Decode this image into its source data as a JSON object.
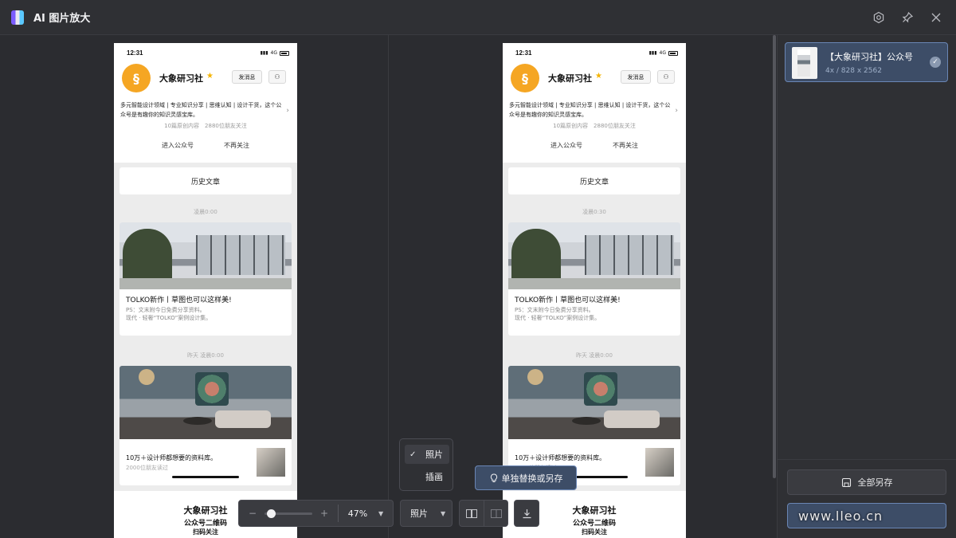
{
  "app": {
    "title": "AI 图片放大",
    "icons": [
      "settings-icon",
      "pin-icon",
      "close-icon"
    ]
  },
  "preview": {
    "status_time": "12:31",
    "status_network": "4G",
    "account_name": "大象研习社",
    "message_button": "发消息",
    "description": "多元智能设计领域 | 专业知识分享 | 思维认知 | 设计干货，这个公众号是有趣你的知识灵感宝库。",
    "stats": "10篇原创内容　2880位朋友关注",
    "enter_link": "进入公众号",
    "unfollow_link": "不再关注",
    "history_label": "历史文章",
    "time_left_1": "凌晨0:00",
    "time_right_1": "凌晨0:30",
    "article1_title": "TOLKO新作丨草图也可以这样美!",
    "article1_sub": "PS：文末附今日免费分享资料。",
    "article1_sub2": "现代 · 轻奢“TOLKO”案例设计集。",
    "time_2": "昨天 凌晨0:00",
    "article2_title": "10万＋设计师都想要的资料库。",
    "article2_sub": "2000位朋友读过",
    "qr_title": "大象研习社",
    "qr_sub": "公众号二维码",
    "qr_sub2": "扫码关注"
  },
  "sidebar": {
    "file_name": "【大象研习社】公众号",
    "file_info": "4x / 828 x 2562",
    "save_all": "全部另存",
    "watermark": "www.lleo.cn"
  },
  "toolbar": {
    "zoom_minus": "−",
    "zoom_plus": "+",
    "zoom_value": "47%",
    "zoom_level": 0.47,
    "mode_value": "照片",
    "download_icon": "download-icon"
  },
  "mode_menu": {
    "options": [
      "照片",
      "插画"
    ],
    "selected": "照片"
  },
  "tooltip": {
    "text": "单独替换或另存"
  },
  "colors": {
    "accent": "#3d4d67",
    "accent_border": "#6a86b5",
    "bg": "#2b2c30"
  }
}
